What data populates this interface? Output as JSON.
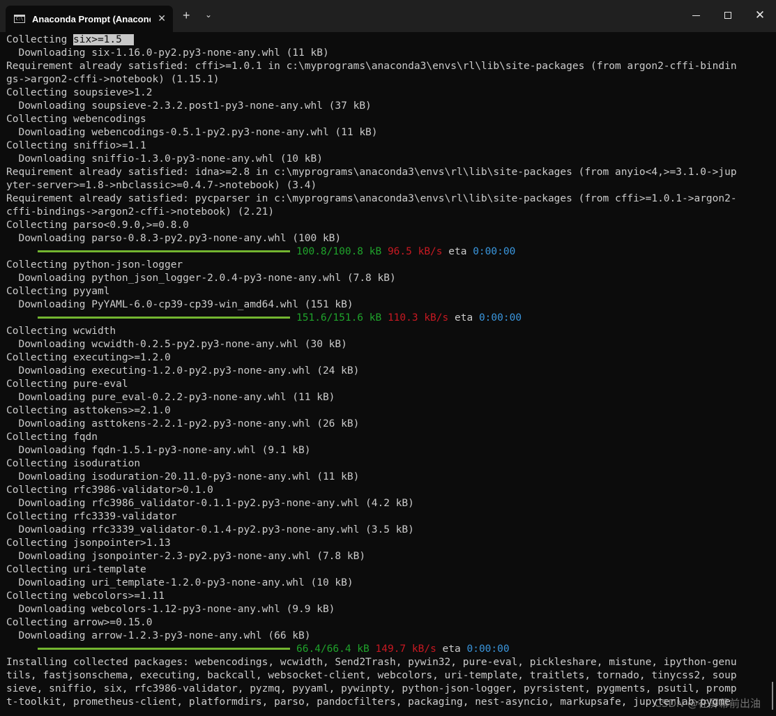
{
  "titlebar": {
    "tab_title": "Anaconda Prompt (Anaconda",
    "tab_icon_text": "C:\\",
    "close_tab": "✕",
    "new_tab": "+",
    "dropdown": "⌄",
    "close_window": "✕"
  },
  "terminal": {
    "lines": [
      "Collecting six>=1.5",
      "  Downloading six-1.16.0-py2.py3-none-any.whl (11 kB)",
      "Requirement already satisfied: cffi>=1.0.1 in c:\\myprograms\\anaconda3\\envs\\rl\\lib\\site-packages (from argon2-cffi-bindin",
      "gs->argon2-cffi->notebook) (1.15.1)",
      "Collecting soupsieve>1.2",
      "  Downloading soupsieve-2.3.2.post1-py3-none-any.whl (37 kB)",
      "Collecting webencodings",
      "  Downloading webencodings-0.5.1-py2.py3-none-any.whl (11 kB)",
      "Collecting sniffio>=1.1",
      "  Downloading sniffio-1.3.0-py3-none-any.whl (10 kB)",
      "Requirement already satisfied: idna>=2.8 in c:\\myprograms\\anaconda3\\envs\\rl\\lib\\site-packages (from anyio<4,>=3.1.0->jup",
      "yter-server>=1.8->nbclassic>=0.4.7->notebook) (3.4)",
      "Requirement already satisfied: pycparser in c:\\myprograms\\anaconda3\\envs\\rl\\lib\\site-packages (from cffi>=1.0.1->argon2-",
      "cffi-bindings->argon2-cffi->notebook) (2.21)",
      "Collecting parso<0.9.0,>=0.8.0",
      "  Downloading parso-0.8.3-py2.py3-none-any.whl (100 kB)",
      "",
      "Collecting python-json-logger",
      "  Downloading python_json_logger-2.0.4-py3-none-any.whl (7.8 kB)",
      "Collecting pyyaml",
      "  Downloading PyYAML-6.0-cp39-cp39-win_amd64.whl (151 kB)",
      "",
      "Collecting wcwidth",
      "  Downloading wcwidth-0.2.5-py2.py3-none-any.whl (30 kB)",
      "Collecting executing>=1.2.0",
      "  Downloading executing-1.2.0-py2.py3-none-any.whl (24 kB)",
      "Collecting pure-eval",
      "  Downloading pure_eval-0.2.2-py3-none-any.whl (11 kB)",
      "Collecting asttokens>=2.1.0",
      "  Downloading asttokens-2.2.1-py2.py3-none-any.whl (26 kB)",
      "Collecting fqdn",
      "  Downloading fqdn-1.5.1-py3-none-any.whl (9.1 kB)",
      "Collecting isoduration",
      "  Downloading isoduration-20.11.0-py3-none-any.whl (11 kB)",
      "Collecting rfc3986-validator>0.1.0",
      "  Downloading rfc3986_validator-0.1.1-py2.py3-none-any.whl (4.2 kB)",
      "Collecting rfc3339-validator",
      "  Downloading rfc3339_validator-0.1.4-py2.py3-none-any.whl (3.5 kB)",
      "Collecting jsonpointer>1.13",
      "  Downloading jsonpointer-2.3-py2.py3-none-any.whl (7.8 kB)",
      "Collecting uri-template",
      "  Downloading uri_template-1.2.0-py3-none-any.whl (10 kB)",
      "Collecting webcolors>=1.11",
      "  Downloading webcolors-1.12-py3-none-any.whl (9.9 kB)",
      "Collecting arrow>=0.15.0",
      "  Downloading arrow-1.2.3-py3-none-any.whl (66 kB)",
      "",
      "Installing collected packages: webencodings, wcwidth, Send2Trash, pywin32, pure-eval, pickleshare, mistune, ipython-genu",
      "tils, fastjsonschema, executing, backcall, websocket-client, webcolors, uri-template, traitlets, tornado, tinycss2, soup",
      "sieve, sniffio, six, rfc3986-validator, pyzmq, pyyaml, pywinpty, python-json-logger, pyrsistent, pygments, psutil, promp",
      "t-toolkit, prometheus-client, platformdirs, parso, pandocfilters, packaging, nest-asyncio, markupsafe, jupyterlab-pygme"
    ],
    "progress": [
      {
        "line_index": 16,
        "done": "100.8/100.8 kB",
        "speed": "96.5 kB/s",
        "eta_label": "eta",
        "eta": "0:00:00",
        "fraction": 1.0
      },
      {
        "line_index": 21,
        "done": "151.6/151.6 kB",
        "speed": "110.3 kB/s",
        "eta_label": "eta",
        "eta": "0:00:00",
        "fraction": 1.0
      },
      {
        "line_index": 46,
        "done": "66.4/66.4 kB",
        "speed": "149.7 kB/s",
        "eta_label": "eta",
        "eta": "0:00:00",
        "fraction": 1.0
      }
    ],
    "selection": {
      "line_index": 0,
      "start": 11,
      "end": 21
    }
  },
  "watermark": "CSDN @在屏幕前出油",
  "colors": {
    "background": "#0c0c0c",
    "text": "#cccccc",
    "progress_bar": "#73b530",
    "progress_done": "#1fa32b",
    "progress_speed": "#c81922",
    "progress_eta": "#3a96dd"
  }
}
